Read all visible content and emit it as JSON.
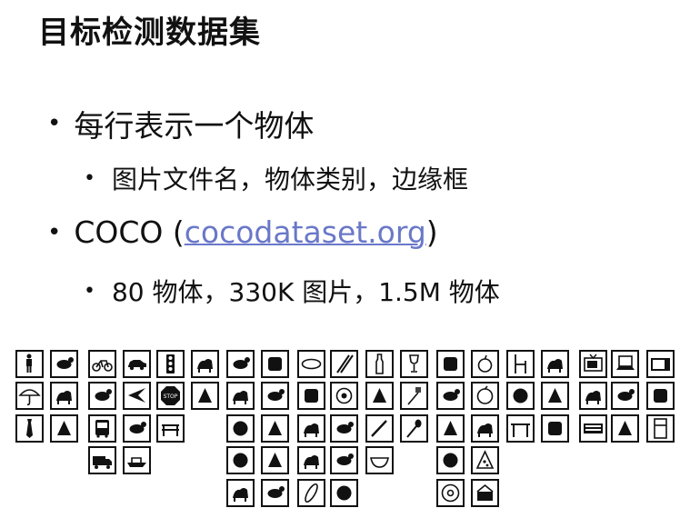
{
  "title": "目标检测数据集",
  "bullets": [
    {
      "text": "每行表示一个物体"
    },
    {
      "text": "图片文件名，物体类别，边缘框"
    },
    {
      "prefix": "COCO (",
      "link": "cocodataset.org",
      "suffix": ")"
    },
    {
      "text": "80 物体，330K 图片，1.5M 物体"
    }
  ],
  "bullet_glyph": "•",
  "icons": [
    "person-icon",
    "backpack-icon",
    "bicycle-icon",
    "car-icon",
    "traffic-light-icon",
    "fire-hydrant-icon",
    "bird-icon",
    "cat-icon",
    "frisbee-icon",
    "skis-icon",
    "bottle-icon",
    "wine-glass-icon",
    "banana-icon",
    "apple-icon",
    "chair-icon",
    "couch-icon",
    "tv-icon",
    "laptop-icon",
    "microwave-icon",
    "umbrella-icon",
    "handbag-icon",
    "motorcycle-icon",
    "airplane-icon",
    "stop-sign-icon",
    "parking-meter-icon",
    "dog-icon",
    "horse-icon",
    "snowboard-icon",
    "sports-ball-icon",
    "cup-icon",
    "fork-icon",
    "sandwich-icon",
    "orange-icon",
    "potted-plant-icon",
    "bed-icon",
    "mouse-icon",
    "remote-icon",
    "oven-icon",
    "tie-icon",
    "suitcase-icon",
    "bus-icon",
    "train-icon",
    "bench-icon",
    "sheep-icon",
    "cow-icon",
    "kite-icon",
    "baseball-bat-icon",
    "knife-icon",
    "spoon-icon",
    "broccoli-icon",
    "carrot-icon",
    "dining-table-icon",
    "toilet-icon",
    "keyboard-icon",
    "cell-phone-icon",
    "refrigerator-icon",
    "truck-icon",
    "boat-icon",
    "elephant-icon",
    "bear-icon",
    "baseball-glove-icon",
    "skateboard-icon",
    "bowl-icon",
    "hot-dog-icon",
    "pizza-icon",
    "zebra-icon",
    "giraffe-icon",
    "surfboard-icon",
    "tennis-racket-icon",
    "donut-icon",
    "cake-icon"
  ],
  "colors": {
    "link": "#6a78c8",
    "text": "#111111"
  }
}
